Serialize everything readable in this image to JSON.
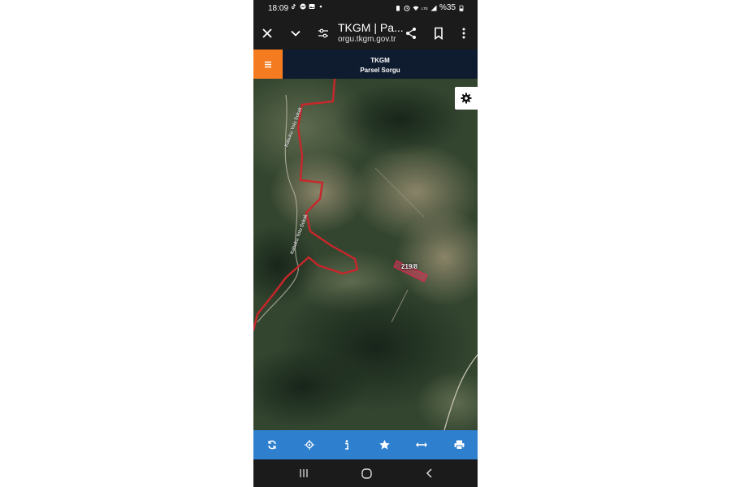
{
  "status_bar": {
    "time": "18:09",
    "battery": "%35",
    "icons": [
      "tiktok-icon",
      "messenger-icon",
      "gallery-icon",
      "dot-icon",
      "battery-saver-icon",
      "alarm-icon",
      "wifi-icon",
      "volte-icon",
      "signal-icon",
      "battery-icon"
    ]
  },
  "browser": {
    "title": "TKGM | Pa...",
    "host": "orgu.tkgm.gov.tr",
    "icons": [
      "close-icon",
      "chevron-down-icon",
      "tune-icon",
      "share-icon",
      "bookmark-icon",
      "more-icon"
    ]
  },
  "site_header": {
    "line1": "TKGM",
    "line2": "Parsel Sorgu",
    "menu_icon": "hamburger-icon",
    "accent": "#f47b20",
    "background": "#0f1b2e"
  },
  "map": {
    "parcel_label": "219/8",
    "road_labels": [
      "Kabuku Yolu Sokak",
      "Kabuku Yolu Sokak"
    ],
    "settings_icon": "gear-icon",
    "boundary_color": "#c9262b"
  },
  "toolbar": {
    "background": "#2f7fcf",
    "icons": [
      "refresh-icon",
      "locate-icon",
      "info-icon",
      "star-icon",
      "measure-icon",
      "print-icon"
    ]
  },
  "nav_bar": {
    "icons": [
      "recents-icon",
      "home-icon",
      "back-icon"
    ]
  }
}
